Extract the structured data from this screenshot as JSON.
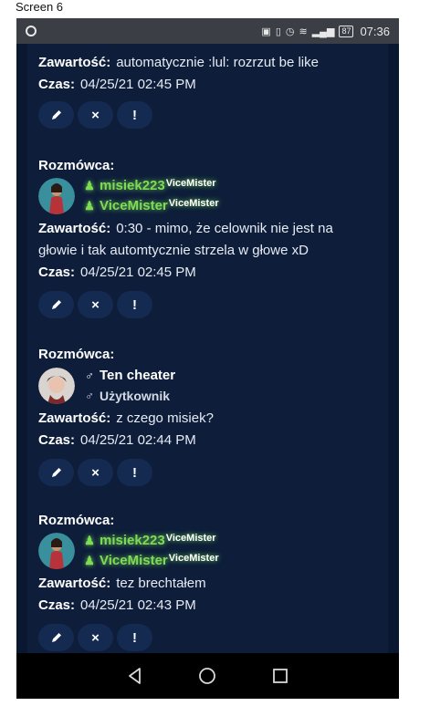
{
  "screen_label": "Screen 6",
  "status_bar": {
    "icons": [
      "messenger-icon",
      "nfc-icon",
      "vibrate-icon",
      "alarm-icon",
      "wifi-icon",
      "signal-icon"
    ],
    "battery": "87",
    "time": "07:36"
  },
  "labels": {
    "speaker": "Rozmówca:",
    "content": "Zawartość:",
    "time": "Czas:"
  },
  "top_partial": {
    "content": "automatycznie :lul: rozrzut be like",
    "time": "04/25/21 02:45 PM"
  },
  "entries": [
    {
      "user_icon": "person-icon",
      "user_name": "misiek223",
      "user_suffix": "ViceMister",
      "role_name": "ViceMister",
      "role_suffix": "ViceMister",
      "content": "0:30 - mimo, że celownik nie jest na",
      "content_line2": "głowie i tak automtycznie strzela w głowe xD",
      "time": "04/25/21 02:45 PM"
    },
    {
      "user_icon": "male-icon",
      "user_name": "Ten cheater",
      "role_name": "Użytkownik",
      "content": "z czego misiek?",
      "time": "04/25/21 02:44 PM"
    },
    {
      "user_icon": "person-icon",
      "user_name": "misiek223",
      "user_suffix": "ViceMister",
      "role_name": "ViceMister",
      "role_suffix": "ViceMister",
      "content": "tez brechtałem",
      "time": "04/25/21 02:43 PM"
    }
  ],
  "buttons": {
    "edit": "edit-icon",
    "delete": "×",
    "report": "!"
  },
  "colors": {
    "background": "#0b1a33",
    "vip_green": "#7ddc54",
    "button_bg": "#142a50"
  }
}
